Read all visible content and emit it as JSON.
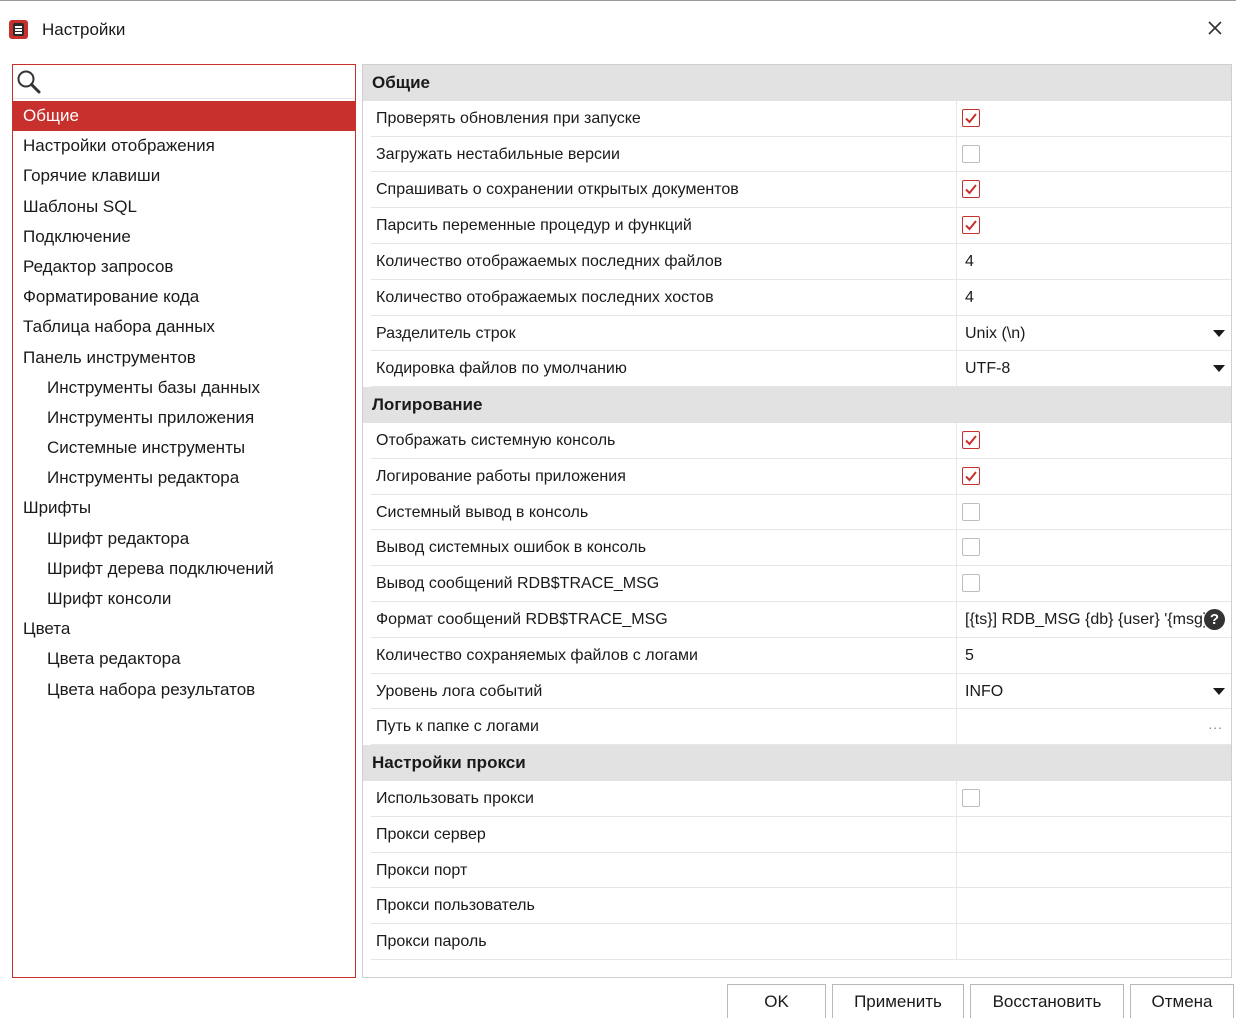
{
  "window": {
    "title": "Настройки"
  },
  "search": {
    "placeholder": ""
  },
  "sidebar": {
    "items": [
      {
        "label": "Общие",
        "level": 0,
        "selected": true
      },
      {
        "label": "Настройки отображения",
        "level": 0
      },
      {
        "label": "Горячие клавиши",
        "level": 0
      },
      {
        "label": "Шаблоны SQL",
        "level": 0
      },
      {
        "label": "Подключение",
        "level": 0
      },
      {
        "label": "Редактор запросов",
        "level": 0
      },
      {
        "label": "Форматирование кода",
        "level": 0
      },
      {
        "label": "Таблица набора данных",
        "level": 0
      },
      {
        "label": "Панель инструментов",
        "level": 0
      },
      {
        "label": "Инструменты базы данных",
        "level": 1
      },
      {
        "label": "Инструменты приложения",
        "level": 1
      },
      {
        "label": "Системные инструменты",
        "level": 1
      },
      {
        "label": "Инструменты редактора",
        "level": 1
      },
      {
        "label": "Шрифты",
        "level": 0
      },
      {
        "label": "Шрифт редактора",
        "level": 1
      },
      {
        "label": "Шрифт дерева подключений",
        "level": 1
      },
      {
        "label": "Шрифт консоли",
        "level": 1
      },
      {
        "label": "Цвета",
        "level": 0
      },
      {
        "label": "Цвета редактора",
        "level": 1
      },
      {
        "label": "Цвета набора результатов",
        "level": 1
      }
    ]
  },
  "sections": [
    {
      "title": "Общие",
      "props": [
        {
          "label": "Проверять обновления при запуске",
          "type": "checkbox",
          "checked": true
        },
        {
          "label": "Загружать нестабильные версии",
          "type": "checkbox",
          "checked": false
        },
        {
          "label": "Спрашивать о сохранении открытых документов",
          "type": "checkbox",
          "checked": true
        },
        {
          "label": "Парсить переменные процедур и функций",
          "type": "checkbox",
          "checked": true
        },
        {
          "label": "Количество отображаемых последних файлов",
          "type": "text",
          "value": "4"
        },
        {
          "label": "Количество отображаемых последних хостов",
          "type": "text",
          "value": "4"
        },
        {
          "label": "Разделитель строк",
          "type": "select",
          "value": "Unix (\\n)"
        },
        {
          "label": "Кодировка файлов по умолчанию",
          "type": "select",
          "value": "UTF-8"
        }
      ]
    },
    {
      "title": "Логирование",
      "props": [
        {
          "label": "Отображать системную консоль",
          "type": "checkbox",
          "checked": true
        },
        {
          "label": "Логирование работы приложения",
          "type": "checkbox",
          "checked": true
        },
        {
          "label": "Системный вывод в консоль",
          "type": "checkbox",
          "checked": false
        },
        {
          "label": "Вывод системных ошибок в консоль",
          "type": "checkbox",
          "checked": false
        },
        {
          "label": "Вывод сообщений RDB$TRACE_MSG",
          "type": "checkbox",
          "checked": false
        },
        {
          "label": "Формат сообщений RDB$TRACE_MSG",
          "type": "text-help",
          "value": "[{ts}] RDB_MSG {db} {user} '{msg}'"
        },
        {
          "label": "Количество сохраняемых файлов с логами",
          "type": "text",
          "value": "5"
        },
        {
          "label": "Уровень лога событий",
          "type": "select",
          "value": "INFO"
        },
        {
          "label": "Путь к папке с логами",
          "type": "path",
          "value": "",
          "button": "..."
        }
      ]
    },
    {
      "title": "Настройки прокси",
      "props": [
        {
          "label": "Использовать прокси",
          "type": "checkbox",
          "checked": false
        },
        {
          "label": "Прокси сервер",
          "type": "text",
          "value": ""
        },
        {
          "label": "Прокси порт",
          "type": "text",
          "value": ""
        },
        {
          "label": "Прокси пользователь",
          "type": "text",
          "value": ""
        },
        {
          "label": "Прокси пароль",
          "type": "text",
          "value": ""
        }
      ]
    }
  ],
  "buttons": {
    "ok": "OK",
    "apply": "Применить",
    "restore": "Восстановить",
    "cancel": "Отмена"
  },
  "colors": {
    "accent": "#c7302c",
    "section_bg": "#e2e2e2"
  }
}
